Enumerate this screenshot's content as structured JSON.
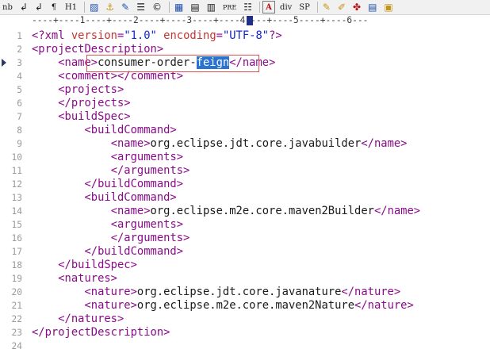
{
  "toolbar": {
    "items": [
      {
        "name": "nb-button",
        "label": "nb"
      },
      {
        "name": "return-arrow-icon",
        "label": "↲"
      },
      {
        "name": "align-left-icon",
        "label": "↲"
      },
      {
        "name": "paragraph-icon",
        "label": "¶"
      },
      {
        "name": "h1-button",
        "label": "H1"
      },
      {
        "name": "image-icon",
        "label": "▨"
      },
      {
        "name": "anchor-icon",
        "label": "⚓"
      },
      {
        "name": "pencil-icon",
        "label": "✎"
      },
      {
        "name": "list-icon",
        "label": "☰"
      },
      {
        "name": "copyright-icon",
        "label": "©"
      },
      {
        "name": "table-icon",
        "label": "▦"
      },
      {
        "name": "grid-icon",
        "label": "▤"
      },
      {
        "name": "column-icon",
        "label": "▥"
      },
      {
        "name": "pre-button",
        "label": "PRE"
      },
      {
        "name": "bullet-list-icon",
        "label": "☷"
      },
      {
        "name": "font-color-icon",
        "label": "A"
      },
      {
        "name": "div-button",
        "label": "div"
      },
      {
        "name": "sp-button",
        "label": "SP"
      },
      {
        "name": "edit-icon",
        "label": "✎"
      },
      {
        "name": "paint-icon",
        "label": "✐"
      },
      {
        "name": "tools-icon",
        "label": "✤"
      },
      {
        "name": "document-icon",
        "label": "▤"
      },
      {
        "name": "window-icon",
        "label": "▣"
      }
    ]
  },
  "ruler": {
    "text": "----+----1----+----2----+----3----+----4----+----5----+----6---"
  },
  "line_numbers": [
    "1",
    "2",
    "3",
    "4",
    "5",
    "6",
    "7",
    "8",
    "9",
    "10",
    "11",
    "12",
    "13",
    "14",
    "15",
    "16",
    "17",
    "18",
    "19",
    "20",
    "21",
    "22",
    "23",
    "24"
  ],
  "code": {
    "l1": {
      "open": "<?xml ",
      "a1": "version",
      "eq1": "=",
      "v1": "\"1.0\"",
      "sp": " ",
      "a2": "encoding",
      "eq2": "=",
      "v2": "\"UTF-8\"",
      "close": "?>"
    },
    "l2": {
      "indent": "",
      "tag": "<projectDescription>"
    },
    "l3": {
      "indent": "    ",
      "open": "<name>",
      "text_a": "consumer-order-",
      "selected": "feign",
      "close": "</name>"
    },
    "l4": {
      "indent": "    ",
      "open": "<comment>",
      "close": "</comment>"
    },
    "l5": {
      "indent": "    ",
      "tag": "<projects>"
    },
    "l6": {
      "indent": "    ",
      "tag": "</projects>"
    },
    "l7": {
      "indent": "    ",
      "tag": "<buildSpec>"
    },
    "l8": {
      "indent": "        ",
      "tag": "<buildCommand>"
    },
    "l9": {
      "indent": "            ",
      "open": "<name>",
      "text": "org.eclipse.jdt.core.javabuilder",
      "close": "</name>"
    },
    "l10": {
      "indent": "            ",
      "tag": "<arguments>"
    },
    "l11": {
      "indent": "            ",
      "tag": "</arguments>"
    },
    "l12": {
      "indent": "        ",
      "tag": "</buildCommand>"
    },
    "l13": {
      "indent": "        ",
      "tag": "<buildCommand>"
    },
    "l14": {
      "indent": "            ",
      "open": "<name>",
      "text": "org.eclipse.m2e.core.maven2Builder",
      "close": "</name>"
    },
    "l15": {
      "indent": "            ",
      "tag": "<arguments>"
    },
    "l16": {
      "indent": "            ",
      "tag": "</arguments>"
    },
    "l17": {
      "indent": "        ",
      "tag": "</buildCommand>"
    },
    "l18": {
      "indent": "    ",
      "tag": "</buildSpec>"
    },
    "l19": {
      "indent": "    ",
      "tag": "<natures>"
    },
    "l20": {
      "indent": "        ",
      "open": "<nature>",
      "text": "org.eclipse.jdt.core.javanature",
      "close": "</nature>"
    },
    "l21": {
      "indent": "        ",
      "open": "<nature>",
      "text": "org.eclipse.m2e.core.maven2Nature",
      "close": "</nature>"
    },
    "l22": {
      "indent": "    ",
      "tag": "</natures>"
    },
    "l23": {
      "indent": "",
      "tag": "</projectDescription>"
    },
    "l24": {
      "indent": "",
      "tag": ""
    }
  },
  "colors": {
    "tag": "#8b0a8b",
    "attr": "#c83333",
    "value": "#1428c8",
    "selection": "#2a73d2",
    "highlight_box": "#e25252"
  }
}
